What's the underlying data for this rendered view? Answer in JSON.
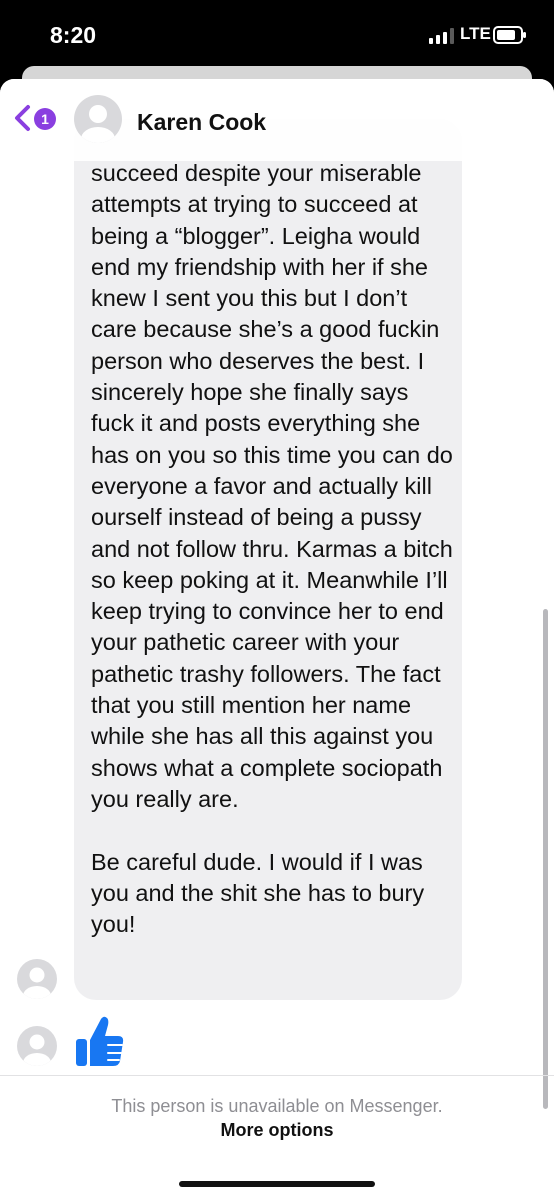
{
  "status_bar": {
    "time": "8:20",
    "network": "LTE",
    "signal_icon": "signal-bars-icon",
    "battery_icon": "battery-icon"
  },
  "header": {
    "back_icon": "chevron-left-icon",
    "unread_count": "1",
    "contact_name": "Karen Cook",
    "avatar_icon": "person-avatar-icon"
  },
  "message": {
    "text": "succeed despite your miserable attempts at trying to succeed at being a “blogger”. Leigha would end my friendship with her if she knew I sent you this but I don’t care because she’s a good fuckin person who deserves the best. I sincerely hope she finally says fuck it and posts everything she has on you so this time you can do everyone a favor and actually kill ourself instead of being a pussy and not follow thru. Karmas a bitch so keep poking at it. Meanwhile I’ll keep trying to convince her to end your pathetic career with your pathetic trashy followers. The fact that you still mention her name while she has all this against you shows what a complete sociopath you really are.\n\nBe careful dude. I would if I was you and the shit she has to bury you!"
  },
  "reaction": {
    "icon": "thumbs-up-icon",
    "color": "#1877f2"
  },
  "footer": {
    "unavailable_text": "This person is unavailable on Messenger.",
    "more_options_label": "More options"
  },
  "colors": {
    "badge": "#8a3fe0",
    "bubble": "#efeff1",
    "back_chevron": "#8a3fe0"
  }
}
